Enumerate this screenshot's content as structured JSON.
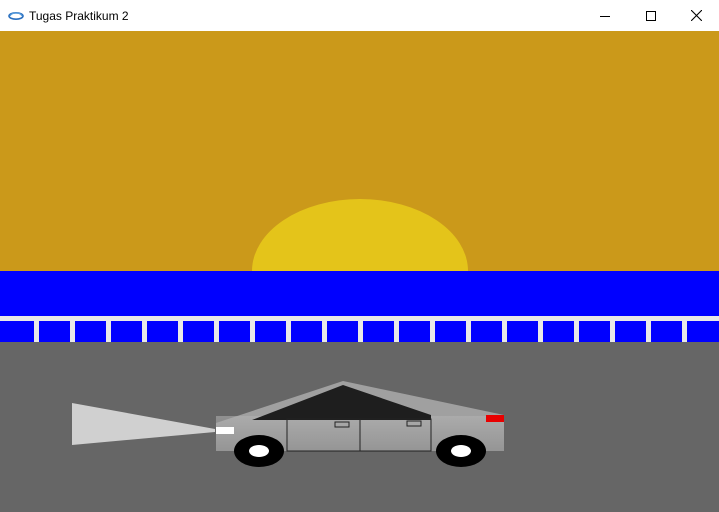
{
  "window": {
    "title": "Tugas Praktikum 2",
    "icon": "opengl-app-icon",
    "controls": [
      "minimize-icon",
      "maximize-icon",
      "close-icon"
    ]
  },
  "scene": {
    "colors": {
      "sky": "#CB991A",
      "sun": "#E4C41A",
      "sea": "#0000FF",
      "rail": "#E8E8E8",
      "road": "#666666",
      "car_body": "#A0A0A0",
      "car_window": "#1E1E1E",
      "headlight": "#FFFFFF",
      "headlight_beam": "#D0D0D0",
      "taillight": "#E80000",
      "tire": "#000000",
      "hubcap": "#FFFFFF"
    },
    "railing_posts": 19
  }
}
